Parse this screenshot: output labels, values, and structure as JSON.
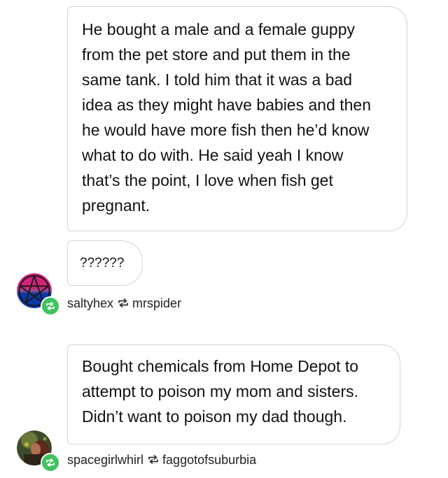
{
  "posts": [
    {
      "message_lines": [
        "He bought a male and a female guppy",
        "from the pet store and put them in the",
        "same tank. I told him that it was a bad",
        "idea as they might have babies and then",
        "he would have more fish then he’d know",
        "what to do with. He said yeah I know",
        "that’s the point, I love when fish get",
        "pregnant."
      ],
      "reply": "??????",
      "reblogger": "saltyhex",
      "source": "mrspider",
      "avatar_icon": "pentacle-icon"
    },
    {
      "message_lines": [
        "Bought chemicals from Home Depot to",
        "attempt to poison my mom and sisters.",
        "Didn’t want to poison my dad though."
      ],
      "reblogger": "spacegirlwhirl",
      "source": "faggotofsuburbia",
      "avatar_icon": "photo-avatar"
    }
  ],
  "colors": {
    "bubble_border": "#d4d4d4",
    "reblog_badge": "#3fc35f"
  }
}
